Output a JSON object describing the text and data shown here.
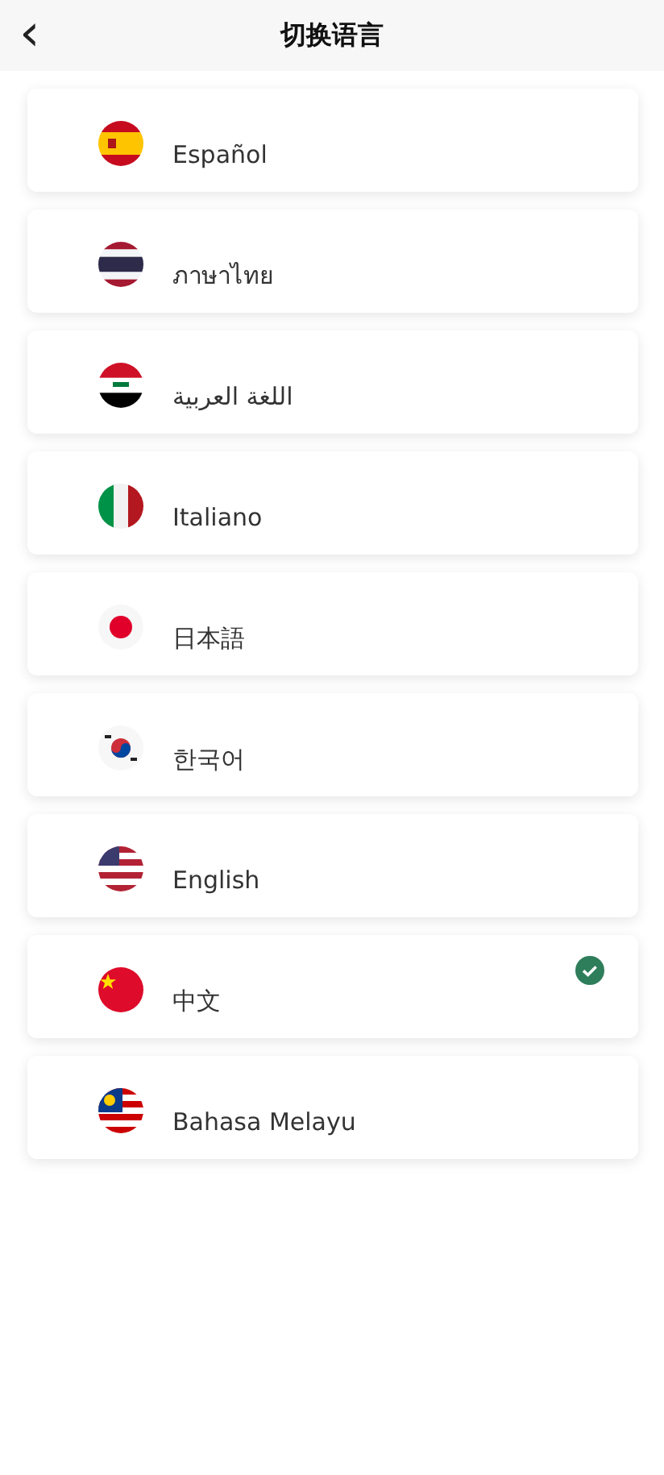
{
  "header": {
    "back": "‹",
    "title": "切换语言"
  },
  "languages": [
    {
      "label": "Español",
      "selected": false
    },
    {
      "label": "ภาษาไทย",
      "selected": false
    },
    {
      "label": "اللغة العربية",
      "selected": false
    },
    {
      "label": "Italiano",
      "selected": false
    },
    {
      "label": "日本語",
      "selected": false
    },
    {
      "label": "한국어",
      "selected": false
    },
    {
      "label": "English",
      "selected": false
    },
    {
      "label": "中文",
      "selected": true
    },
    {
      "label": "Bahasa Melayu",
      "selected": false
    }
  ]
}
